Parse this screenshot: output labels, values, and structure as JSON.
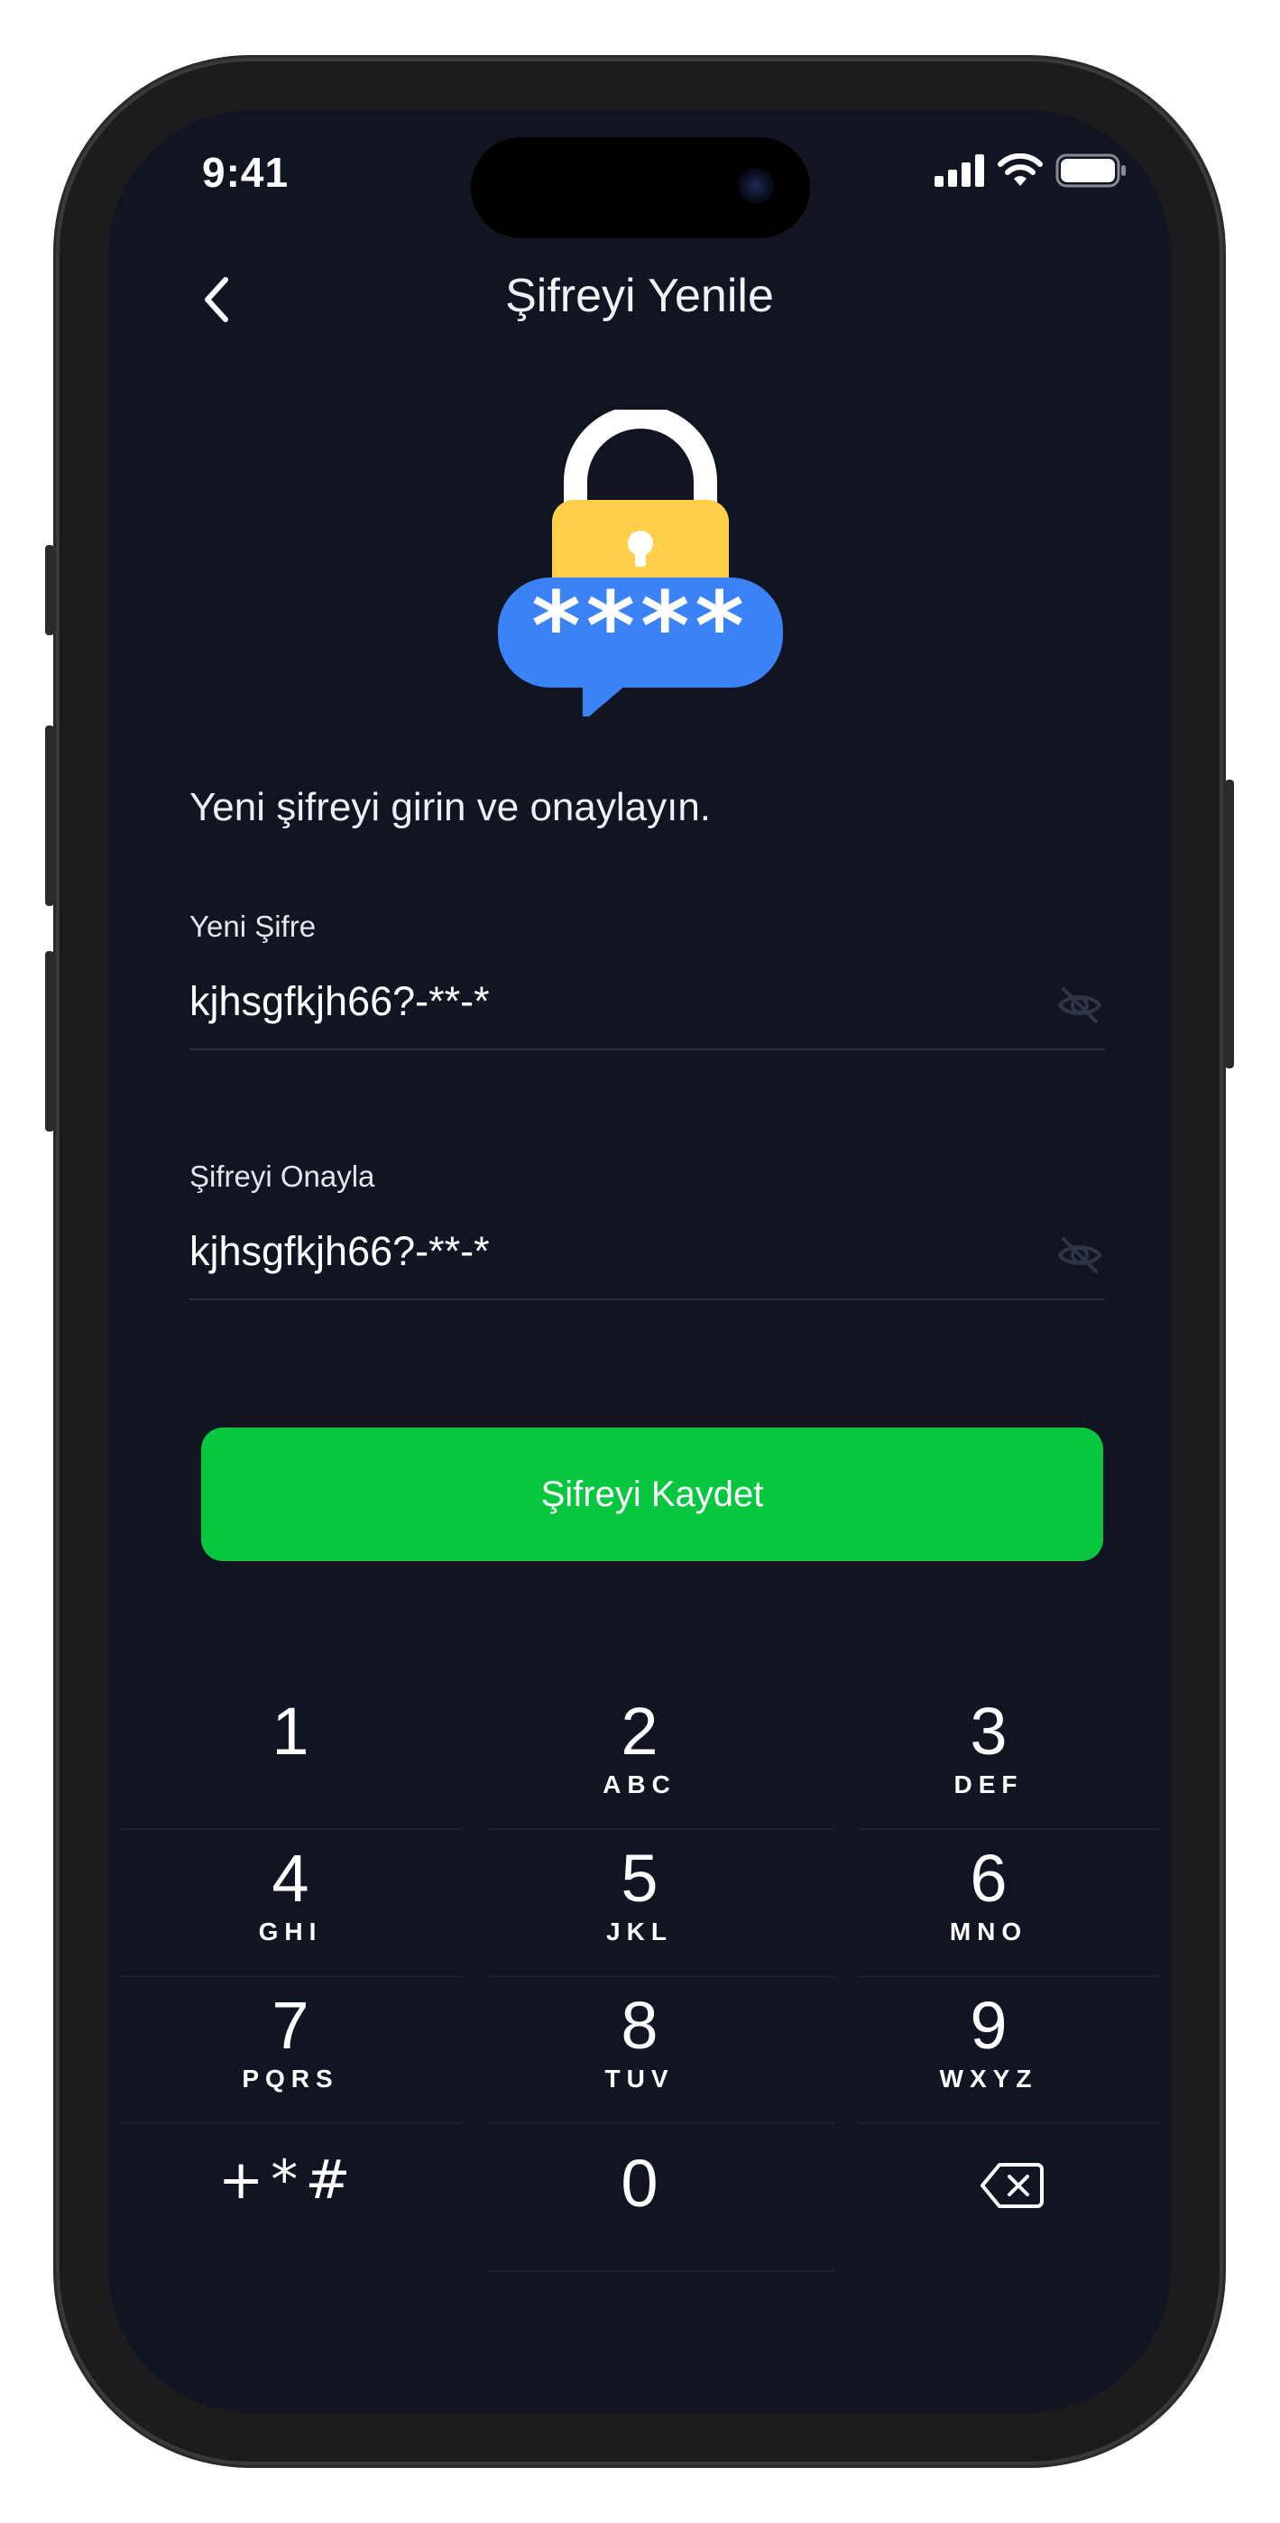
{
  "status_bar": {
    "time": "9:41"
  },
  "nav": {
    "title": "Şifreyi Yenile",
    "back_icon": "chevron-left-icon"
  },
  "illustration": {
    "icon": "lock-password-icon",
    "masked_text": "****",
    "colors": {
      "lock_body": "#FFCF4A",
      "lock_shackle": "#FFFFFF",
      "bubble": "#3B82F6"
    }
  },
  "instruction": "Yeni şifreyi girin ve onaylayın.",
  "form": {
    "new_password": {
      "label": "Yeni Şifre",
      "value": "kjhsgfkjh66?-**-*",
      "toggle_icon": "eye-off-icon"
    },
    "confirm_password": {
      "label": "Şifreyi Onayla",
      "value": "kjhsgfkjh66?-**-*",
      "toggle_icon": "eye-off-icon"
    }
  },
  "save_button": {
    "label": "Şifreyi Kaydet",
    "color": "#07C63F"
  },
  "keypad": {
    "keys": [
      {
        "digit": "1",
        "letters": ""
      },
      {
        "digit": "2",
        "letters": "ABC"
      },
      {
        "digit": "3",
        "letters": "DEF"
      },
      {
        "digit": "4",
        "letters": "GHI"
      },
      {
        "digit": "5",
        "letters": "JKL"
      },
      {
        "digit": "6",
        "letters": "MNO"
      },
      {
        "digit": "7",
        "letters": "PQRS"
      },
      {
        "digit": "8",
        "letters": "TUV"
      },
      {
        "digit": "9",
        "letters": "WXYZ"
      }
    ],
    "symbols": "+*#",
    "zero": "0",
    "delete_icon": "backspace-icon"
  },
  "theme": {
    "background": "#111522",
    "text": "#FFFFFF"
  }
}
